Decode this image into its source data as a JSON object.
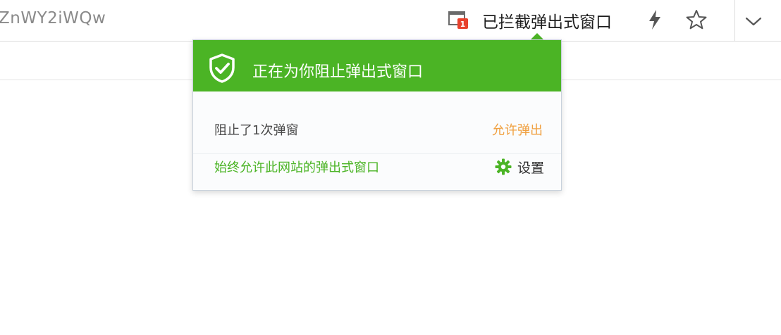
{
  "addressbar": {
    "url_fragment": "ZnWY2iWQw",
    "blocked_popup_label": "已拦截弹出式窗口",
    "blocked_badge_count": "1"
  },
  "popup": {
    "title": "正在为你阻止弹出式窗口",
    "blocked_text": "阻止了1次弹窗",
    "allow_link": "允许弹出",
    "always_allow_link": "始终允许此网站的弹出式窗口",
    "settings_label": "设置"
  },
  "colors": {
    "accent_green": "#4bb425",
    "allow_orange": "#f0a040",
    "badge_red": "#e8412c"
  },
  "icons": {
    "blocked": "popup-blocked-icon",
    "bolt": "lightning-icon",
    "star": "star-icon",
    "chevron": "chevron-down-icon",
    "shield": "shield-check-icon",
    "gear": "gear-icon"
  }
}
